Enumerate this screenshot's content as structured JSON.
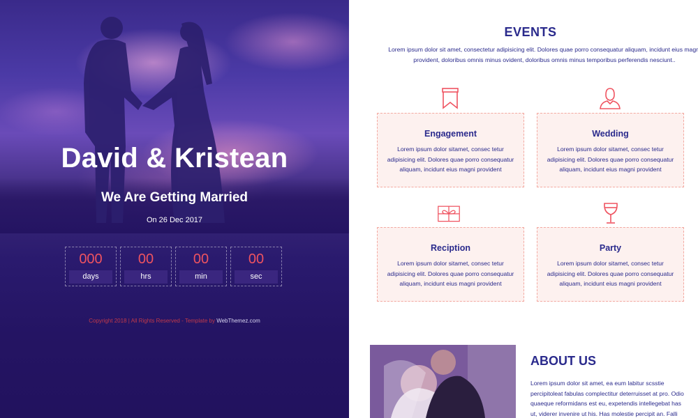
{
  "hero": {
    "title": "David & Kristean",
    "subtitle": "We Are Getting Married",
    "date": "On 26 Dec 2017",
    "countdown": [
      {
        "value": "000",
        "unit": "days"
      },
      {
        "value": "00",
        "unit": "hrs"
      },
      {
        "value": "00",
        "unit": "min"
      },
      {
        "value": "00",
        "unit": "sec"
      }
    ],
    "footer": {
      "copyright": "Copyright 2018 | All Rights Reserved - Template by",
      "brand": "WebThemez.com"
    }
  },
  "events": {
    "title": "EVENTS",
    "description": "Lorem ipsum dolor sit amet, consectetur adipisicing elit. Dolores quae porro consequatur aliquam, incidunt eius magni provident, doloribus omnis minus ovident, doloribus omnis minus temporibus perferendis nesciunt..",
    "cards": [
      {
        "icon": "bookmark-icon",
        "title": "Engagement",
        "text": "Lorem ipsum dolor sitamet, consec tetur adipisicing elit. Dolores quae porro consequatur aliquam, incidunt eius magni provident"
      },
      {
        "icon": "person-icon",
        "title": "Wedding",
        "text": "Lorem ipsum dolor sitamet, consec tetur adipisicing elit. Dolores quae porro consequatur aliquam, incidunt eius magni provident"
      },
      {
        "icon": "gift-icon",
        "title": "Reciption",
        "text": "Lorem ipsum dolor sitamet, consec tetur adipisicing elit. Dolores quae porro consequatur aliquam, incidunt eius magni provident"
      },
      {
        "icon": "wine-glass-icon",
        "title": "Party",
        "text": "Lorem ipsum dolor sitamet, consec tetur adipisicing elit. Dolores quae porro consequatur aliquam, incidunt eius magni provident"
      }
    ]
  },
  "about": {
    "title": "ABOUT US",
    "text": "Lorem ipsum dolor sit amet, ea eum labitur scsstie percipitoleat fabulas complectitur deterruisset at pro. Odio quaeque reformidans est eu, expetendis intellegebat has ut, viderer invenire ut his. Has molestie percipit an. Falli"
  },
  "colors": {
    "accent": "#ef5360",
    "navy": "#2a2a8c",
    "card_bg": "#fdf1ef",
    "hero_bg": "#2a1a6e"
  }
}
